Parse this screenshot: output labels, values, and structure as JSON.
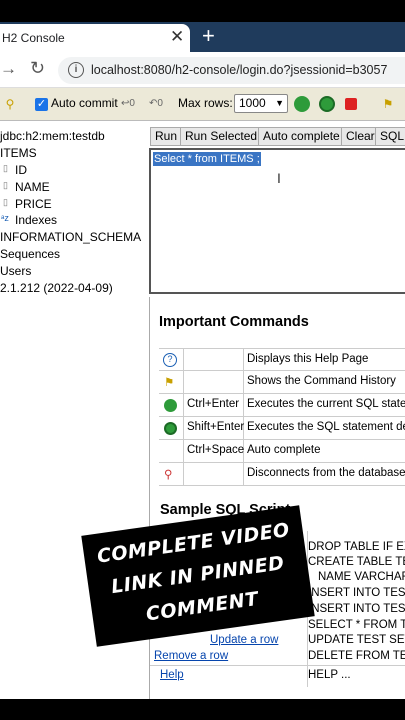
{
  "browser": {
    "tab_title": "H2 Console",
    "tab_close": "✕",
    "new_tab": "+",
    "url": "localhost:8080/h2-console/login.do?jsessionid=b3057"
  },
  "toolbar": {
    "auto_commit_label": "Auto commit",
    "max_rows_label": "Max rows:",
    "max_rows_value": "1000"
  },
  "tree": {
    "db": "jdbc:h2:mem:testdb",
    "table": "ITEMS",
    "columns": [
      "ID",
      "NAME",
      "PRICE"
    ],
    "indexes": "Indexes",
    "schema": "INFORMATION_SCHEMA",
    "sequences": "Sequences",
    "users": "Users",
    "version": "2.1.212 (2022-04-09)"
  },
  "query_buttons": [
    "Run",
    "Run Selected",
    "Auto complete",
    "Clear",
    "SQL s"
  ],
  "editor": {
    "text": "Select * from ITEMS ;"
  },
  "important": {
    "title": "Important Commands",
    "rows": [
      {
        "key": "",
        "desc": "Displays this Help Page"
      },
      {
        "key": "",
        "desc": "Shows the Command History"
      },
      {
        "key": "Ctrl+Enter",
        "desc": "Executes the current SQL staten"
      },
      {
        "key": "Shift+Enter",
        "desc": "Executes the SQL statement def"
      },
      {
        "key": "Ctrl+Space",
        "desc": "Auto complete"
      },
      {
        "key": "",
        "desc": "Disconnects from the database"
      }
    ]
  },
  "sample": {
    "title": "Sample SQL Script",
    "sql": [
      "DROP TABLE IF EX",
      "CREATE TABLE TE",
      "NAME VARCHAR",
      "INSERT INTO TES",
      "INSERT INTO TES",
      "SELECT * FROM T",
      "UPDATE TEST SET",
      "DELETE FROM TE"
    ],
    "left_links": [
      "Update a row",
      "Remove a row"
    ],
    "help_left": "Help",
    "help_right": "HELP ..."
  },
  "overlay": {
    "lines": [
      "COMPLETE VIDEO",
      "LINK IN PINNED",
      "COMMENT"
    ]
  },
  "colors": {
    "tabbar": "#1f3b5c",
    "toolbar": "#ece9d8",
    "selection": "#3a75c4"
  }
}
